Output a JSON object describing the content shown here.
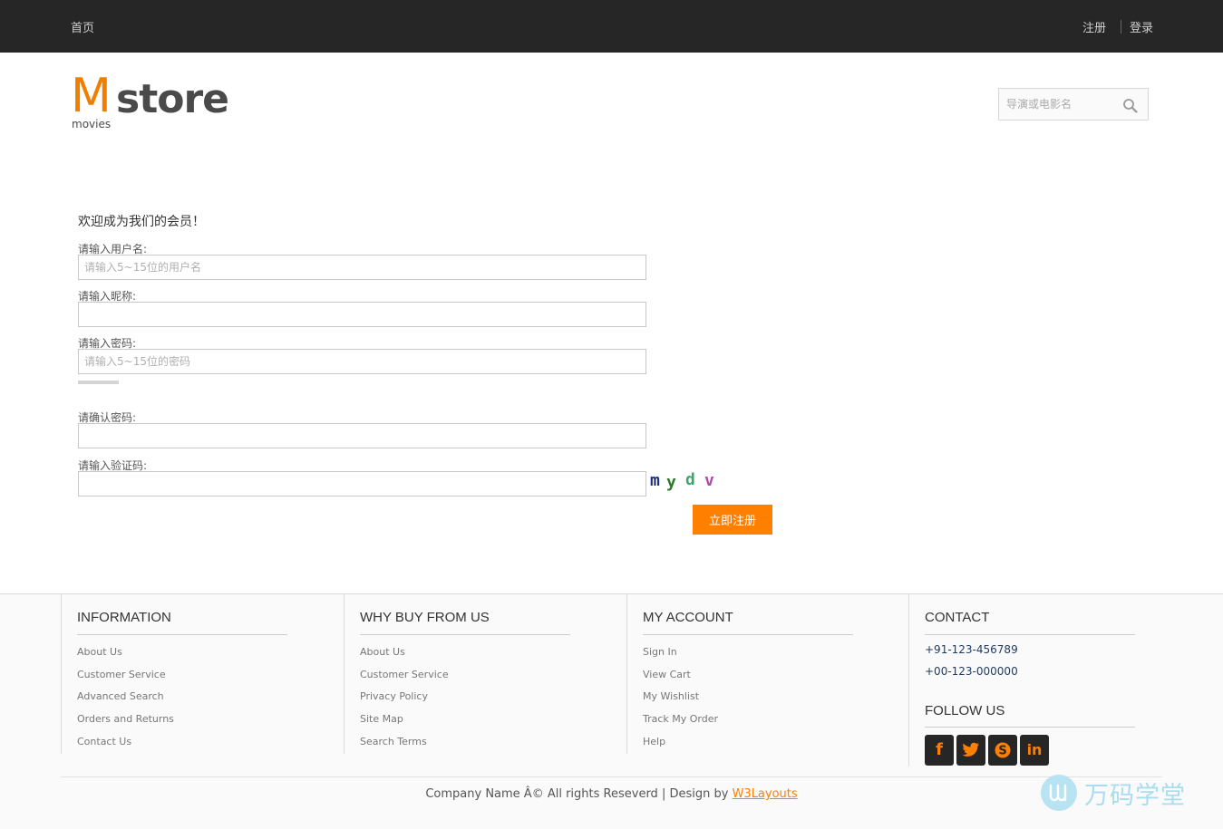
{
  "topbar": {
    "home": "首页",
    "register": "注册",
    "login": "登录"
  },
  "logo": {
    "m": "M",
    "store": "store",
    "sub": "movies"
  },
  "search": {
    "placeholder": "导演或电影名",
    "icon": "search-icon"
  },
  "form": {
    "welcome": "欢迎成为我们的会员！",
    "username_label": "请输入用户名:",
    "username_placeholder": "请输入5~15位的用户名",
    "nickname_label": "请输入昵称:",
    "password_label": "请输入密码:",
    "password_placeholder": "请输入5~15位的密码",
    "confirm_label": "请确认密码:",
    "captcha_label": "请输入验证码:",
    "captcha_chars": [
      "m",
      "y",
      "d",
      "v"
    ],
    "captcha_colors": [
      "#1a2a8a",
      "#2a7a2a",
      "#3aa86a",
      "#b04aa8"
    ],
    "submit": "立即注册"
  },
  "footer": {
    "information": {
      "title": "INFORMATION",
      "items": [
        "About Us",
        "Customer Service",
        "Advanced Search",
        "Orders and Returns",
        "Contact Us"
      ]
    },
    "why": {
      "title": "WHY BUY FROM US",
      "items": [
        "About Us",
        "Customer Service",
        "Privacy Policy",
        "Site Map",
        "Search Terms"
      ]
    },
    "account": {
      "title": "MY ACCOUNT",
      "items": [
        "Sign In",
        "View Cart",
        "My Wishlist",
        "Track My Order",
        "Help"
      ]
    },
    "contact": {
      "title": "CONTACT",
      "phone1": "+91-123-456789",
      "phone2": "+00-123-000000",
      "follow": "FOLLOW US",
      "social": [
        {
          "icon": "facebook-icon",
          "glyph": "f"
        },
        {
          "icon": "twitter-icon",
          "glyph": "t"
        },
        {
          "icon": "skype-icon",
          "glyph": "S"
        },
        {
          "icon": "linkedin-icon",
          "glyph": "in"
        }
      ]
    },
    "copyright": "Company Name Â© All rights Reseverd | Design by",
    "designer": "W3Layouts"
  },
  "watermark": {
    "text": "万码学堂"
  },
  "colors": {
    "accent": "#ff7f00",
    "topbar": "#262626",
    "logo_orange": "#f07f00"
  }
}
